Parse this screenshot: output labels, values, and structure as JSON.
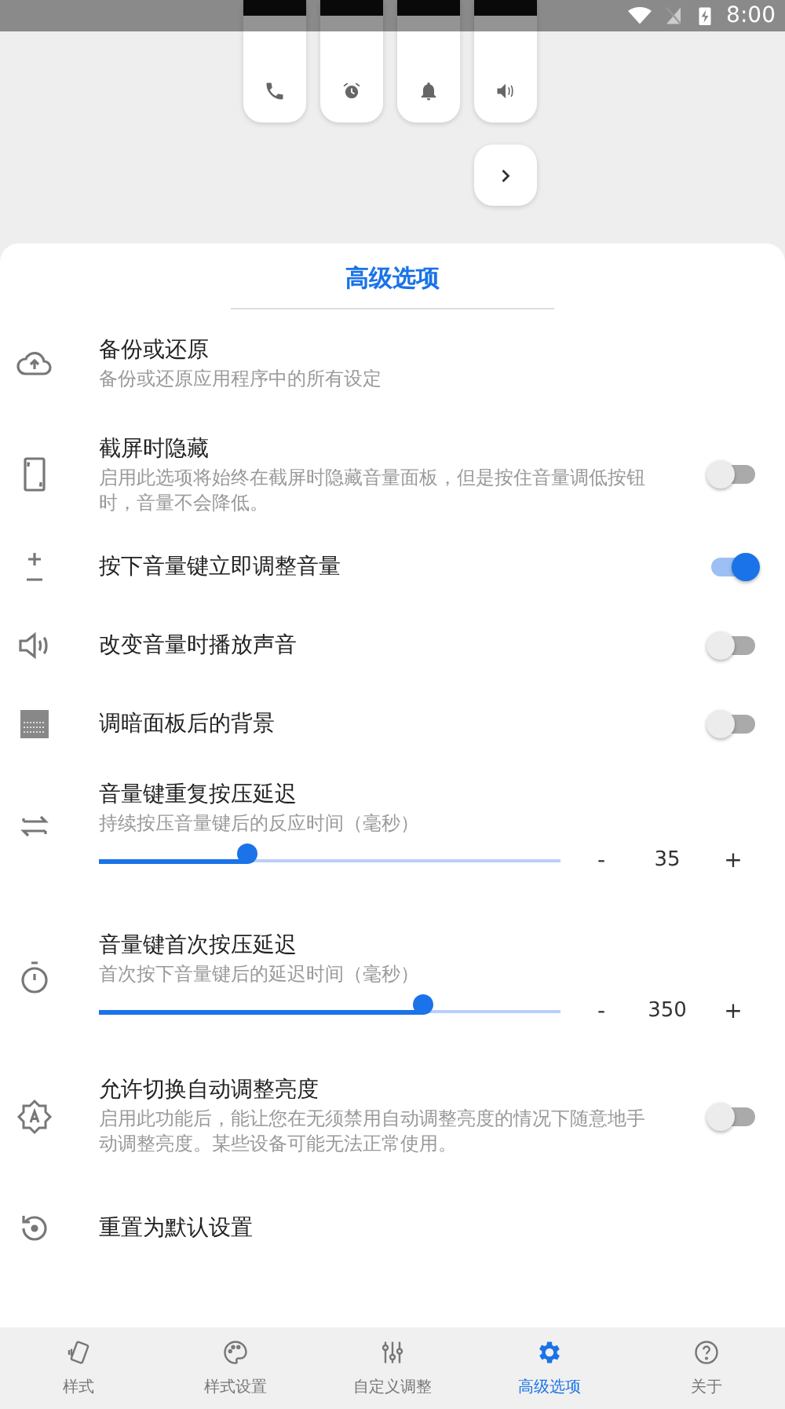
{
  "status_bar": {
    "time": "8:00"
  },
  "sheet": {
    "title": "高级选项"
  },
  "settings": [
    {
      "kind": "action",
      "title": "备份或还原",
      "subtitle": "备份或还原应用程序中的所有设定"
    },
    {
      "kind": "toggle",
      "title": "截屏时隐藏",
      "subtitle": "启用此选项将始终在截屏时隐藏音量面板，但是按住音量调低按钮时，音量不会降低。",
      "on": false
    },
    {
      "kind": "toggle",
      "title": "按下音量键立即调整音量",
      "on": true
    },
    {
      "kind": "toggle",
      "title": "改变音量时播放声音",
      "on": false
    },
    {
      "kind": "toggle",
      "title": "调暗面板后的背景",
      "on": false
    },
    {
      "kind": "slider",
      "title": "音量键重复按压延迟",
      "subtitle": "持续按压音量键后的反应时间（毫秒）",
      "level": 0.32,
      "minus": "-",
      "value": "35",
      "plus": "+"
    },
    {
      "kind": "slider",
      "title": "音量键首次按压延迟",
      "subtitle": "首次按下音量键后的延迟时间（毫秒）",
      "level": 0.7,
      "minus": "-",
      "value": "350",
      "plus": "+"
    },
    {
      "kind": "toggle",
      "title": "允许切换自动调整亮度",
      "subtitle": "启用此功能后，能让您在无须禁用自动调整亮度的情况下随意地手动调整亮度。某些设备可能无法正常使用。",
      "on": false
    },
    {
      "kind": "action",
      "title": "重置为默认设置"
    }
  ],
  "bottom_nav": [
    {
      "label": "样式",
      "selected": false
    },
    {
      "label": "样式设置",
      "selected": false
    },
    {
      "label": "自定义调整",
      "selected": false
    },
    {
      "label": "高级选项",
      "selected": true
    },
    {
      "label": "关于",
      "selected": false
    }
  ]
}
